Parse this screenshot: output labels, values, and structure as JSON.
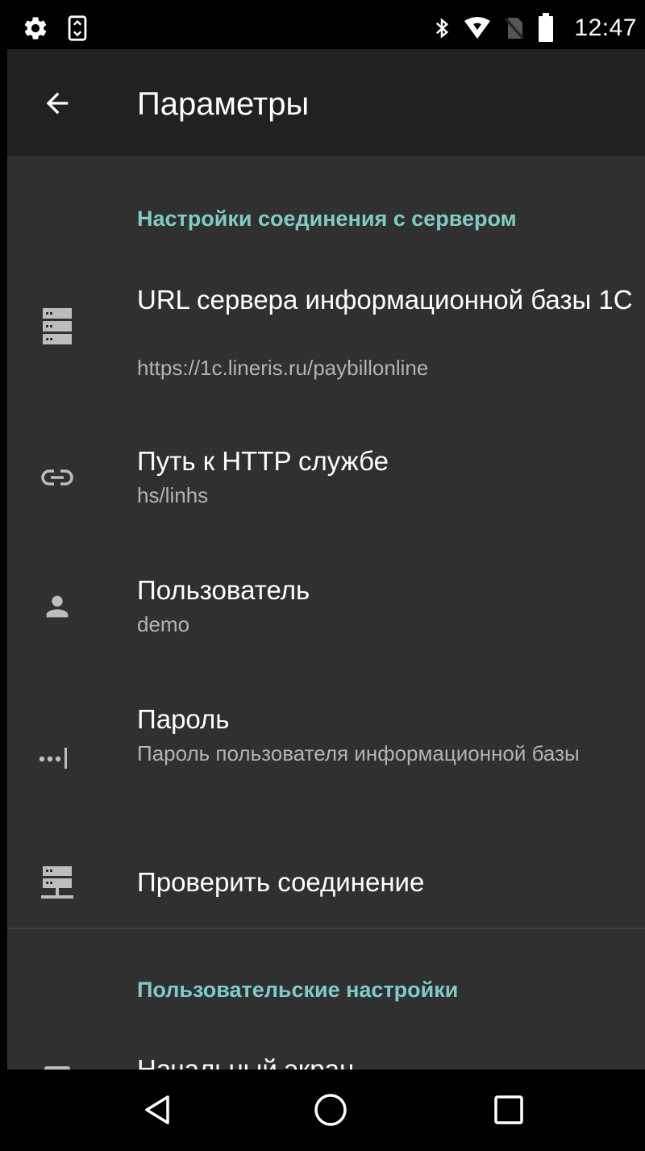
{
  "status_bar": {
    "time": "12:47",
    "left_icons": [
      "settings-gear-icon",
      "screen-rotation-icon"
    ],
    "right_icons": [
      "bluetooth-icon",
      "wifi-icon",
      "no-sim-icon",
      "battery-icon"
    ]
  },
  "toolbar": {
    "title": "Параметры",
    "back_icon": "arrow-back-icon"
  },
  "sections": [
    {
      "header": "Настройки соединения с сервером",
      "items": [
        {
          "icon": "server-icon",
          "title": "URL сервера информационной базы 1С",
          "summary": "https://1c.lineris.ru/paybillonline"
        },
        {
          "icon": "link-icon",
          "title": "Путь к HTTP службе",
          "summary": "hs/linhs"
        },
        {
          "icon": "person-icon",
          "title": "Пользователь",
          "summary": "demo"
        },
        {
          "icon": "password-icon",
          "title": "Пароль",
          "summary": "Пароль пользователя информационной базы"
        },
        {
          "icon": "server-network-icon",
          "title": "Проверить соединение",
          "summary": ""
        }
      ]
    },
    {
      "header": "Пользовательские настройки",
      "items": [
        {
          "icon": "screen-icon",
          "title": "Начальный экран",
          "summary": ""
        }
      ]
    }
  ],
  "colors": {
    "background": "#303030",
    "toolbar": "#212121",
    "accent": "#80cbc4",
    "summary": "#b3b3b3"
  },
  "nav_bar": {
    "icons": [
      "nav-back-icon",
      "nav-home-icon",
      "nav-recents-icon"
    ]
  }
}
